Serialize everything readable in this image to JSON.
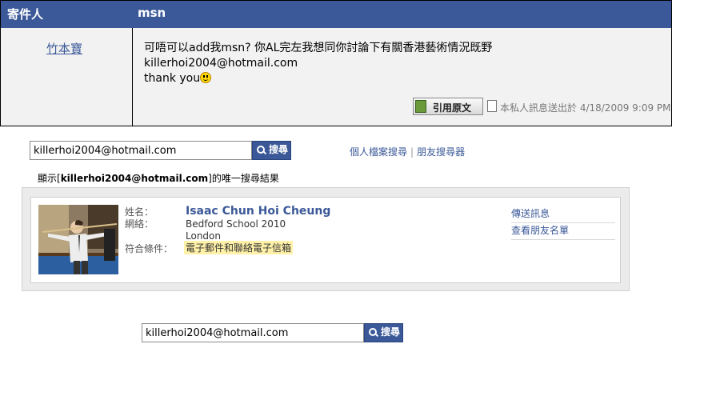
{
  "message": {
    "header_sender": "寄件人",
    "header_subject": "msn",
    "sender_name": "竹本寶",
    "body_lines": [
      "可唔可以add我msn? 你AL完左我想同你討論下有關香港藝術情況既野",
      "killerhoi2004@hotmail.com",
      "thank you"
    ],
    "quote_button": "引用原文",
    "sent_info": "本私人訊息送出於 4/18/2009 9:09 PM"
  },
  "search_top": {
    "value": "killerhoi2004@hotmail.com",
    "button": "搜尋",
    "links": [
      "個人檔案搜尋",
      "朋友搜尋器"
    ]
  },
  "results_info": {
    "prefix": "顯示[",
    "query": "killerhoi2004@hotmail.com",
    "suffix": "]的唯一搜尋結果"
  },
  "result": {
    "labels": {
      "name": "姓名：",
      "network": "網絡：",
      "match": "符合條件："
    },
    "name": "Isaac Chun Hoi Cheung",
    "network_lines": [
      "Bedford School 2010",
      "London"
    ],
    "match": "電子郵件和聯絡電子信箱",
    "actions": [
      "傳送訊息",
      "查看朋友名單"
    ]
  },
  "search_bottom": {
    "value": "killerhoi2004@hotmail.com",
    "button": "搜尋"
  },
  "colors": {
    "brand": "#3b5998",
    "highlight": "#fff1a8"
  }
}
